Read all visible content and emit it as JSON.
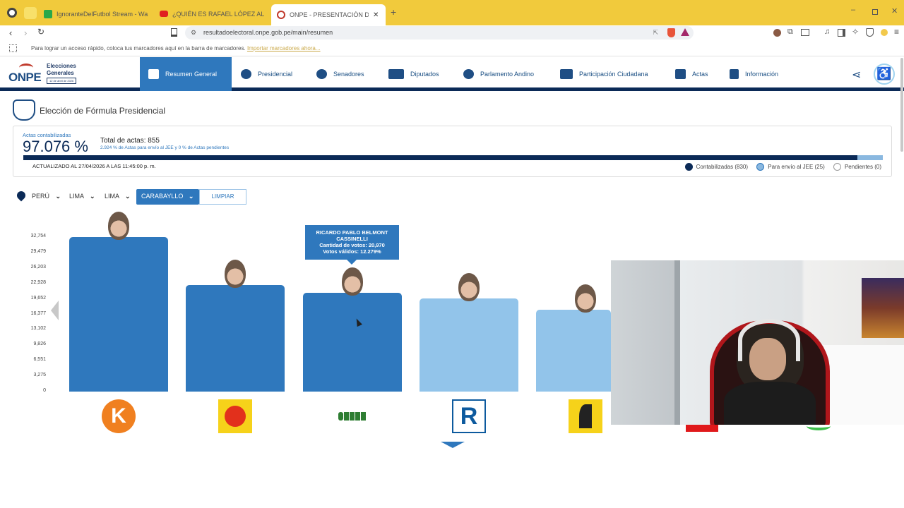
{
  "browser": {
    "tabs": [
      {
        "label": "IgnoranteDelFutbol Stream - Wa"
      },
      {
        "label": "¿QUIÉN ES RAFAEL LÓPEZ ALIAGA? |"
      },
      {
        "label": "ONPE - PRESENTACIÓN DE RES"
      }
    ],
    "url": "resultadoelectoral.onpe.gob.pe/main/resumen",
    "bookmarks_hint": "Para lograr un acceso rápido, coloca tus marcadores aquí en la barra de marcadores.",
    "bookmarks_link": "Importar marcadores ahora..."
  },
  "header": {
    "logo_text": "ONPE",
    "brand_line1": "Elecciones",
    "brand_line2": "Generales",
    "brand_date": "12 de abril de 2026",
    "nav": [
      {
        "label": "Resumen General",
        "icon": "grid-icon"
      },
      {
        "label": "Presidencial",
        "icon": "seal-icon"
      },
      {
        "label": "Senadores",
        "icon": "senate-icon"
      },
      {
        "label": "Diputados",
        "icon": "building-icon"
      },
      {
        "label": "Parlamento Andino",
        "icon": "globe-icon"
      },
      {
        "label": "Participación Ciudadana",
        "icon": "people-icon"
      },
      {
        "label": "Actas",
        "icon": "check-doc-icon"
      },
      {
        "label": "Información",
        "icon": "info-doc-icon"
      }
    ]
  },
  "main": {
    "title": "Elección de Fórmula Presidencial",
    "actas_label": "Actas contabilizadas",
    "actas_percent": "97.076 %",
    "progress_fraction": 0.9708,
    "total_actas": "Total de actas: 855",
    "actas_detail": "2.924 % de Actas para envío al JEE y 0 % de Actas pendientes",
    "updated": "ACTUALIZADO AL 27/04/2026 A LAS 11:45:00 p. m.",
    "legend": [
      {
        "label": "Contabilizadas (830)",
        "color": "#0b2a57"
      },
      {
        "label": "Para envío al JEE (25)",
        "color": "#8ab8e0"
      },
      {
        "label": "Pendientes (0)",
        "color": "#ffffff"
      }
    ]
  },
  "filters": {
    "country": "PERÚ",
    "region": "LIMA",
    "province": "LIMA",
    "district": "CARABAYLLO",
    "clear": "LIMPIAR"
  },
  "chart_data": {
    "type": "bar",
    "yticks": [
      "32,754",
      "29,479",
      "26,203",
      "22,928",
      "19,652",
      "16,377",
      "13,102",
      "9,826",
      "6,551",
      "3,275",
      "0"
    ],
    "ylim": [
      0,
      32754
    ],
    "values": [
      32754,
      22600,
      20970,
      19800,
      17300
    ],
    "colors": [
      "#2f78bd",
      "#2f78bd",
      "#2f78bd",
      "#92c4ea",
      "#92c4ea"
    ],
    "logos": [
      "k-logo",
      "sun-logo",
      "obras-logo",
      "r-logo",
      "road-logo"
    ],
    "tooltip": {
      "name": "RICARDO PABLO BELMONT CASSINELLI",
      "votes": "Cantidad de votos: 20,970",
      "valid": "Votos válidos: 12.279%"
    }
  },
  "overlay": {
    "type": "webcam"
  }
}
